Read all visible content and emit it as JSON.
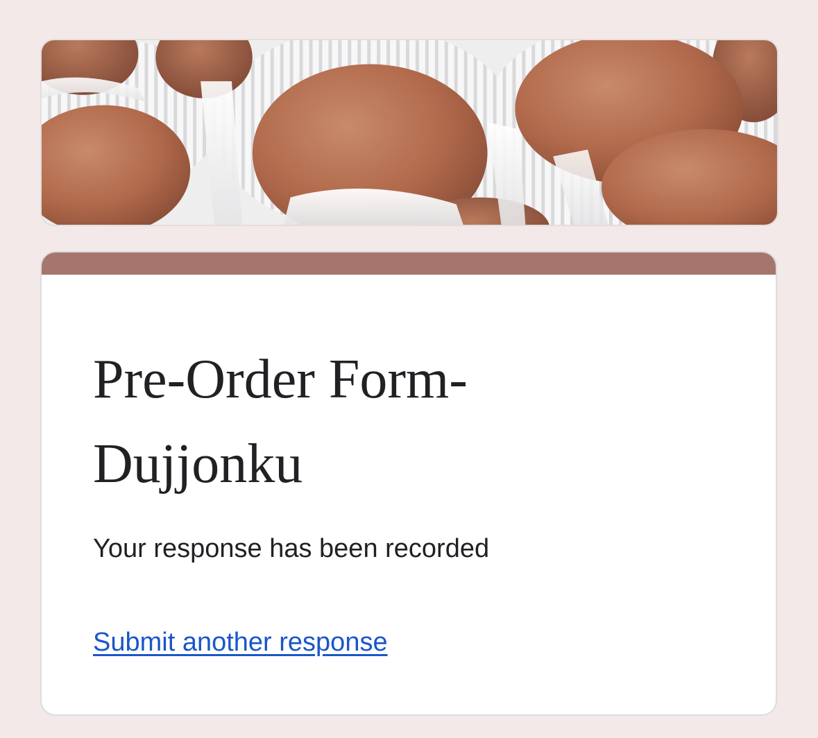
{
  "header": {
    "image_name": "chocolate-truffles-banner"
  },
  "form": {
    "title": "Pre-Order Form- Dujjonku",
    "confirmation_message": "Your response has been recorded",
    "submit_another_label": "Submit another response"
  },
  "colors": {
    "page_background": "#f2e9e8",
    "accent": "#a6766d",
    "link": "#1a56c8",
    "text": "#202124"
  }
}
